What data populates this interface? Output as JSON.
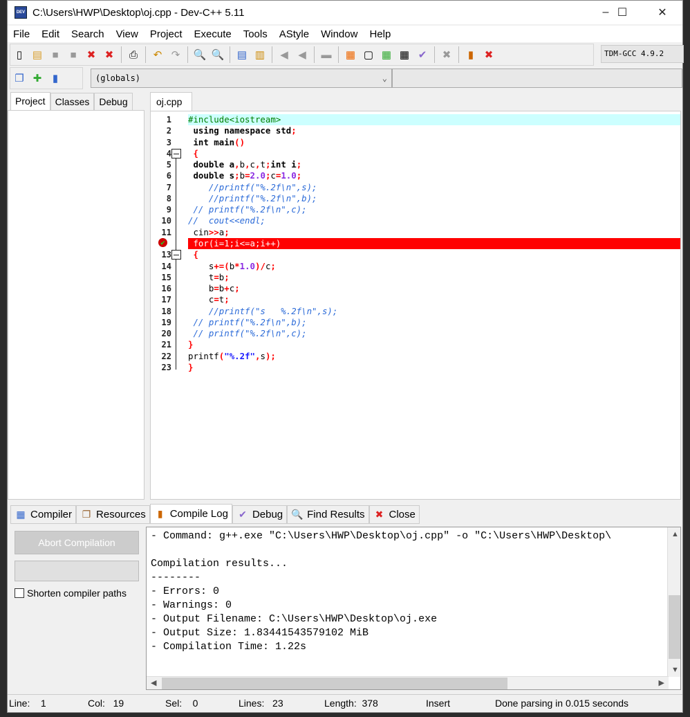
{
  "window": {
    "title": "C:\\Users\\HWP\\Desktop\\oj.cpp - Dev-C++ 5.11",
    "icon_text": "DEV",
    "minimize": "–",
    "maximize": "☐",
    "close": "✕"
  },
  "menu": [
    "File",
    "Edit",
    "Search",
    "View",
    "Project",
    "Execute",
    "Tools",
    "AStyle",
    "Window",
    "Help"
  ],
  "toolbar": {
    "compiler": "TDM-GCC 4.9.2",
    "scope": "(globals)"
  },
  "left_tabs": [
    "Project",
    "Classes",
    "Debug"
  ],
  "editor_tab": "oj.cpp",
  "code": [
    [
      [
        "#include<iostream>",
        "pre"
      ]
    ],
    [
      [
        " using namespace std",
        "kw"
      ],
      [
        ";",
        "sym"
      ]
    ],
    [
      [
        " int main",
        "kw"
      ],
      [
        "()",
        "sym"
      ]
    ],
    [
      [
        " {",
        "sym"
      ]
    ],
    [
      [
        " double a",
        "kw"
      ],
      [
        ",",
        "sym"
      ],
      [
        "b",
        "id"
      ],
      [
        ",",
        "sym"
      ],
      [
        "c",
        "id"
      ],
      [
        ",",
        "sym"
      ],
      [
        "t",
        "id"
      ],
      [
        ";",
        "sym"
      ],
      [
        "int i",
        "kw"
      ],
      [
        ";",
        "sym"
      ]
    ],
    [
      [
        " double s",
        "kw"
      ],
      [
        ";",
        "sym"
      ],
      [
        "b",
        "id"
      ],
      [
        "=",
        "sym"
      ],
      [
        "2.0",
        "num"
      ],
      [
        ";",
        "sym"
      ],
      [
        "c",
        "id"
      ],
      [
        "=",
        "sym"
      ],
      [
        "1.0",
        "num"
      ],
      [
        ";",
        "sym"
      ]
    ],
    [
      [
        "    //printf(\"%.2f\\n\",s);",
        "com"
      ]
    ],
    [
      [
        "    //printf(\"%.2f\\n\",b);",
        "com"
      ]
    ],
    [
      [
        " // printf(\"%.2f\\n\",c);",
        "com"
      ]
    ],
    [
      [
        "//  cout<<endl;",
        "com"
      ]
    ],
    [
      [
        " cin",
        "id"
      ],
      [
        ">>",
        "sym"
      ],
      [
        "a",
        "id"
      ],
      [
        ";",
        "sym"
      ]
    ],
    [
      [
        " for(i=1;i<=a;i++)",
        "id"
      ]
    ],
    [
      [
        " {",
        "sym"
      ]
    ],
    [
      [
        "    s",
        "id"
      ],
      [
        "+=(",
        "sym"
      ],
      [
        "b",
        "id"
      ],
      [
        "*",
        "sym"
      ],
      [
        "1.0",
        "num"
      ],
      [
        ")/",
        "sym"
      ],
      [
        "c",
        "id"
      ],
      [
        ";",
        "sym"
      ]
    ],
    [
      [
        "    t",
        "id"
      ],
      [
        "=",
        "sym"
      ],
      [
        "b",
        "id"
      ],
      [
        ";",
        "sym"
      ]
    ],
    [
      [
        "    b",
        "id"
      ],
      [
        "=",
        "sym"
      ],
      [
        "b",
        "id"
      ],
      [
        "+",
        "sym"
      ],
      [
        "c",
        "id"
      ],
      [
        ";",
        "sym"
      ]
    ],
    [
      [
        "    c",
        "id"
      ],
      [
        "=",
        "sym"
      ],
      [
        "t",
        "id"
      ],
      [
        ";",
        "sym"
      ]
    ],
    [
      [
        "    //printf(\"s   %.2f\\n\",s);",
        "com"
      ]
    ],
    [
      [
        " // printf(\"%.2f\\n\",b);",
        "com"
      ]
    ],
    [
      [
        " // printf(\"%.2f\\n\",c);",
        "com"
      ]
    ],
    [
      [
        "}",
        "sym"
      ]
    ],
    [
      [
        "printf",
        "id"
      ],
      [
        "(",
        "sym"
      ],
      [
        "\"%.2f\"",
        "str"
      ],
      [
        ",",
        "sym"
      ],
      [
        "s",
        "id"
      ],
      [
        ");",
        "sym"
      ]
    ],
    [
      [
        "}",
        "sym"
      ]
    ]
  ],
  "bottom_tabs": [
    {
      "label": "Compiler",
      "icon": "compiler-grid-icon"
    },
    {
      "label": "Resources",
      "icon": "resources-icon"
    },
    {
      "label": "Compile Log",
      "icon": "bar-chart-icon"
    },
    {
      "label": "Debug",
      "icon": "checkmark-icon"
    },
    {
      "label": "Find Results",
      "icon": "find-icon"
    },
    {
      "label": "Close",
      "icon": "close-icon"
    }
  ],
  "compile_panel": {
    "abort": "Abort Compilation",
    "shorten": "Shorten compiler paths"
  },
  "compile_log": [
    "- Command: g++.exe \"C:\\Users\\HWP\\Desktop\\oj.cpp\" -o \"C:\\Users\\HWP\\Desktop\\",
    "",
    "Compilation results...",
    "--------",
    "- Errors: 0",
    "- Warnings: 0",
    "- Output Filename: C:\\Users\\HWP\\Desktop\\oj.exe",
    "- Output Size: 1.83441543579102 MiB",
    "- Compilation Time: 1.22s"
  ],
  "status": {
    "line": "Line:    1",
    "col": "Col:   19",
    "sel": "Sel:    0",
    "lines": "Lines:   23",
    "length": "Length:  378",
    "mode": "Insert",
    "message": "Done parsing in 0.015 seconds"
  },
  "colors": {
    "highlight_line": "#ccffff",
    "breakpoint_line": "#ff0000",
    "comment": "#2a6ad8",
    "symbol": "#ff0000",
    "number": "#8a2be2"
  }
}
